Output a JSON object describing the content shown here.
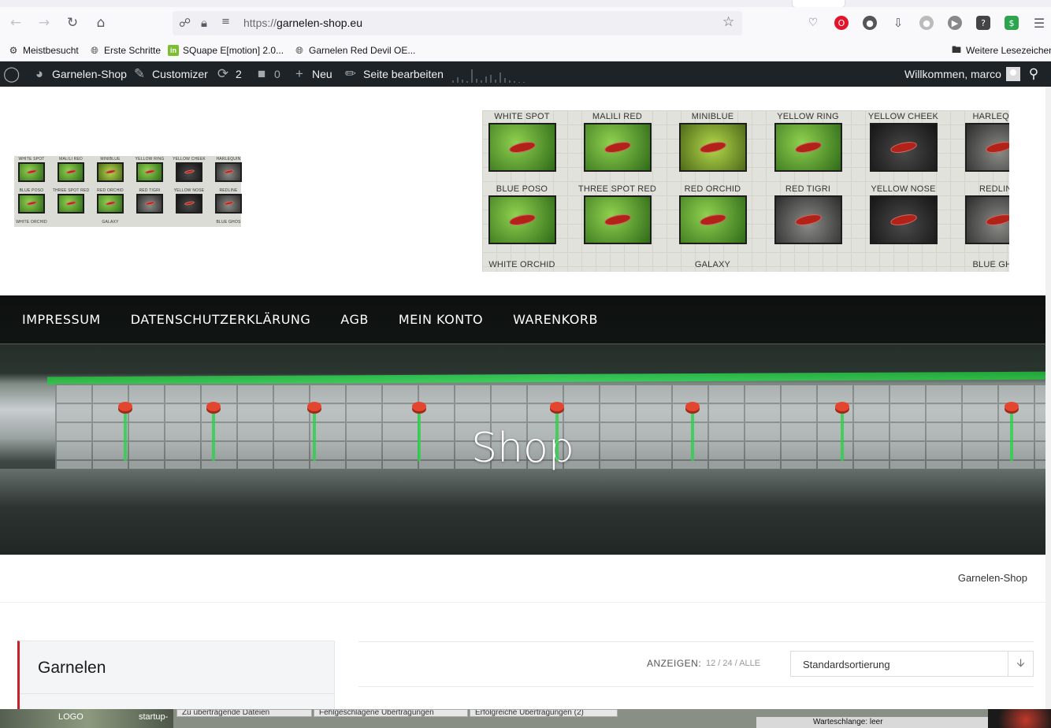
{
  "browser": {
    "url_protocol": "https://",
    "url_host": "garnelen-shop.eu",
    "bookmarks": [
      {
        "label": "Meistbesucht",
        "icon": "gear-icon"
      },
      {
        "label": "Erste Schritte",
        "icon": "globe-icon"
      },
      {
        "label": "SQuape E[motion] 2.0...",
        "icon": "site-favicon-green"
      },
      {
        "label": "Garnelen Red Devil OE...",
        "icon": "globe-icon"
      }
    ],
    "other_bookmarks": "Weitere Lesezeichen"
  },
  "adminbar": {
    "site_name": "Garnelen-Shop",
    "customizer": "Customizer",
    "updates_count": "2",
    "comments_count": "0",
    "new_label": "Neu",
    "edit_page": "Seite bearbeiten",
    "welcome": "Willkommen, marco"
  },
  "header": {
    "banner_labels_top": [
      "WHITE SPOT",
      "MALILI RED",
      "MINIBLUE",
      "YELLOW RING",
      "YELLOW CHEEK",
      "HARLEQUIN"
    ],
    "banner_labels_mid": [
      "BLUE POSO",
      "THREE SPOT RED",
      "RED ORCHID",
      "RED TIGRI",
      "YELLOW NOSE",
      "REDLINE"
    ],
    "banner_labels_bottom": [
      "WHITE ORCHID",
      "GALAXY",
      "BLUE GHOS"
    ]
  },
  "nav": {
    "items": [
      "IMPRESSUM",
      "DATENSCHUTZERKLÄRUNG",
      "AGB",
      "MEIN KONTO",
      "WARENKORB"
    ]
  },
  "hero": {
    "title": "Shop"
  },
  "breadcrumb": {
    "text": "Garnelen-Shop"
  },
  "sidebar": {
    "widget_title": "Garnelen"
  },
  "toolbar": {
    "show_label": "ANZEIGEN:",
    "show_options": "12 / 24 / ALLE",
    "sort_value": "Standardsortierung"
  },
  "taskbar": {
    "logo_label": "LOGO",
    "startup_label": "startup-",
    "tab1": "Zu übertragende Dateien",
    "tab2": "Fehlgeschlagene Übertragungen",
    "tab3": "Erfolgreiche Übertragungen (2)",
    "tray_text": "Warteschlange: leer"
  },
  "colors": {
    "adminbar_bg": "#1d2327",
    "accent_red": "#c8202a"
  }
}
